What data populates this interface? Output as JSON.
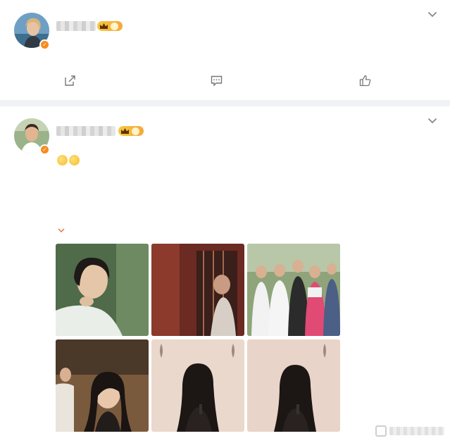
{
  "post1": {
    "time": "",
    "level": "",
    "text": "",
    "actions": {
      "repost": "",
      "comment": "",
      "like": ""
    }
  },
  "post2": {
    "time": "",
    "level": "",
    "tag1": "",
    "text1": "",
    "text2": "",
    "text3": "",
    "text4": "",
    "tag2": "",
    "preview": "",
    "expand_label": ""
  },
  "icons": [
    "chevron-down-icon",
    "crown-icon",
    "verified-icon",
    "repost-icon",
    "comment-icon",
    "like-icon",
    "sweat-emoji-icon",
    "glasses-emoji-icon"
  ],
  "colors": {
    "accent": "#eb7340",
    "verified": "#f78b1f",
    "background": "#f1f2f5"
  }
}
